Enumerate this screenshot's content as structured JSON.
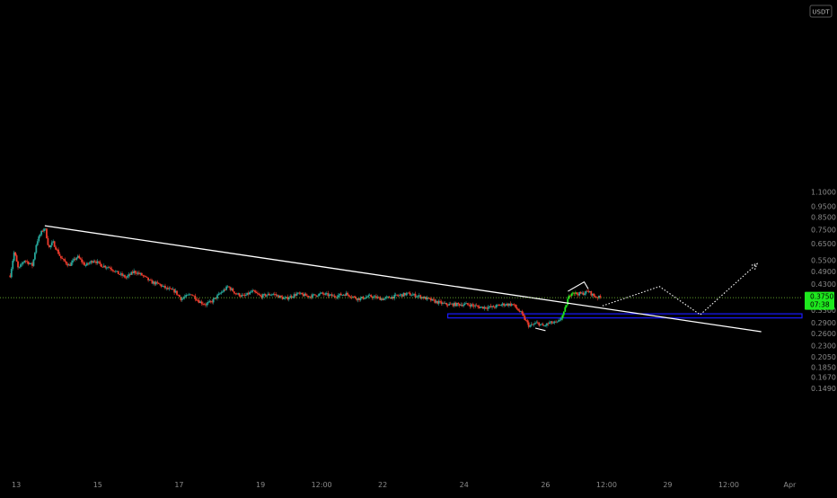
{
  "chart_data": {
    "type": "candlestick",
    "currency_unit": "USDT",
    "y_scale": "log",
    "ylim": [
      0.14,
      1.18
    ],
    "xlim": [
      12.6,
      32.3
    ],
    "grid": false,
    "colors": {
      "background": "#000000",
      "up": "#26a69a",
      "up_bright": "#1ee81e",
      "down": "#ef3b2c",
      "trendline": "#ffffff",
      "projection": "#ffffff",
      "zone_border": "#1a1aff",
      "price_line": "#7ccf3a",
      "price_badge": "#1ee81e"
    },
    "y_ticks": [
      {
        "value": 1.1,
        "label": "1.1000"
      },
      {
        "value": 0.95,
        "label": "0.9500"
      },
      {
        "value": 0.85,
        "label": "0.8500"
      },
      {
        "value": 0.75,
        "label": "0.7500"
      },
      {
        "value": 0.65,
        "label": "0.6500"
      },
      {
        "value": 0.55,
        "label": "0.5500"
      },
      {
        "value": 0.49,
        "label": "0.4900"
      },
      {
        "value": 0.43,
        "label": "0.4300"
      },
      {
        "value": 0.33,
        "label": "0.3300"
      },
      {
        "value": 0.29,
        "label": "0.2900"
      },
      {
        "value": 0.26,
        "label": "0.2600"
      },
      {
        "value": 0.23,
        "label": "0.2300"
      },
      {
        "value": 0.205,
        "label": "0.2050"
      },
      {
        "value": 0.185,
        "label": "0.1850"
      },
      {
        "value": 0.167,
        "label": "0.1670"
      },
      {
        "value": 0.149,
        "label": "0.1490"
      }
    ],
    "x_ticks": [
      {
        "value": 13,
        "label": "13"
      },
      {
        "value": 15,
        "label": "15"
      },
      {
        "value": 17,
        "label": "17"
      },
      {
        "value": 19,
        "label": "19"
      },
      {
        "value": 20.5,
        "label": "12:00"
      },
      {
        "value": 22,
        "label": "22"
      },
      {
        "value": 24,
        "label": "24"
      },
      {
        "value": 26,
        "label": "26"
      },
      {
        "value": 27.5,
        "label": "12:00"
      },
      {
        "value": 29,
        "label": "29"
      },
      {
        "value": 30.5,
        "label": "12:00"
      },
      {
        "value": 32,
        "label": "Apr"
      }
    ],
    "current_price": {
      "value": 0.375,
      "label": "0.3750",
      "countdown": "07:38"
    },
    "price_path": [
      [
        12.85,
        0.47
      ],
      [
        12.95,
        0.6
      ],
      [
        13.05,
        0.5
      ],
      [
        13.2,
        0.55
      ],
      [
        13.4,
        0.52
      ],
      [
        13.5,
        0.66
      ],
      [
        13.6,
        0.72
      ],
      [
        13.7,
        0.77
      ],
      [
        13.8,
        0.62
      ],
      [
        13.9,
        0.66
      ],
      [
        14.1,
        0.56
      ],
      [
        14.3,
        0.52
      ],
      [
        14.5,
        0.57
      ],
      [
        14.7,
        0.52
      ],
      [
        14.9,
        0.55
      ],
      [
        15.1,
        0.52
      ],
      [
        15.3,
        0.51
      ],
      [
        15.5,
        0.48
      ],
      [
        15.7,
        0.46
      ],
      [
        15.9,
        0.49
      ],
      [
        16.1,
        0.47
      ],
      [
        16.3,
        0.44
      ],
      [
        16.5,
        0.43
      ],
      [
        16.7,
        0.41
      ],
      [
        16.9,
        0.4
      ],
      [
        17.05,
        0.37
      ],
      [
        17.3,
        0.39
      ],
      [
        17.5,
        0.36
      ],
      [
        17.65,
        0.35
      ],
      [
        17.8,
        0.36
      ],
      [
        18.0,
        0.39
      ],
      [
        18.2,
        0.42
      ],
      [
        18.4,
        0.39
      ],
      [
        18.6,
        0.38
      ],
      [
        18.8,
        0.4
      ],
      [
        19.0,
        0.38
      ],
      [
        19.3,
        0.39
      ],
      [
        19.6,
        0.37
      ],
      [
        19.9,
        0.39
      ],
      [
        20.2,
        0.38
      ],
      [
        20.5,
        0.39
      ],
      [
        20.8,
        0.38
      ],
      [
        21.1,
        0.39
      ],
      [
        21.4,
        0.37
      ],
      [
        21.7,
        0.38
      ],
      [
        22.0,
        0.37
      ],
      [
        22.3,
        0.38
      ],
      [
        22.6,
        0.39
      ],
      [
        22.9,
        0.38
      ],
      [
        23.1,
        0.37
      ],
      [
        23.3,
        0.36
      ],
      [
        23.55,
        0.35
      ],
      [
        23.8,
        0.35
      ],
      [
        24.1,
        0.35
      ],
      [
        24.4,
        0.34
      ],
      [
        24.7,
        0.34
      ],
      [
        24.95,
        0.35
      ],
      [
        25.2,
        0.35
      ],
      [
        25.4,
        0.32
      ],
      [
        25.6,
        0.28
      ],
      [
        25.8,
        0.29
      ],
      [
        25.95,
        0.28
      ],
      [
        26.1,
        0.29
      ],
      [
        26.3,
        0.29
      ],
      [
        26.45,
        0.32
      ],
      [
        26.55,
        0.37
      ],
      [
        26.65,
        0.4
      ],
      [
        26.75,
        0.39
      ],
      [
        26.9,
        0.39
      ],
      [
        27.05,
        0.4
      ],
      [
        27.2,
        0.38
      ],
      [
        27.35,
        0.375
      ]
    ],
    "trendlines": [
      {
        "from": [
          13.7,
          0.78
        ],
        "to": [
          31.3,
          0.265
        ]
      }
    ],
    "markers": [
      {
        "points": [
          [
            25.75,
            0.275
          ],
          [
            26.0,
            0.268
          ]
        ]
      },
      {
        "points": [
          [
            26.55,
            0.4
          ],
          [
            26.95,
            0.44
          ],
          [
            27.05,
            0.41
          ]
        ]
      }
    ],
    "projection": [
      [
        27.4,
        0.345
      ],
      [
        28.8,
        0.42
      ],
      [
        29.8,
        0.315
      ],
      [
        31.2,
        0.53
      ]
    ],
    "zone": {
      "x_from": 23.6,
      "y_low": 0.305,
      "y_high": 0.318
    }
  }
}
